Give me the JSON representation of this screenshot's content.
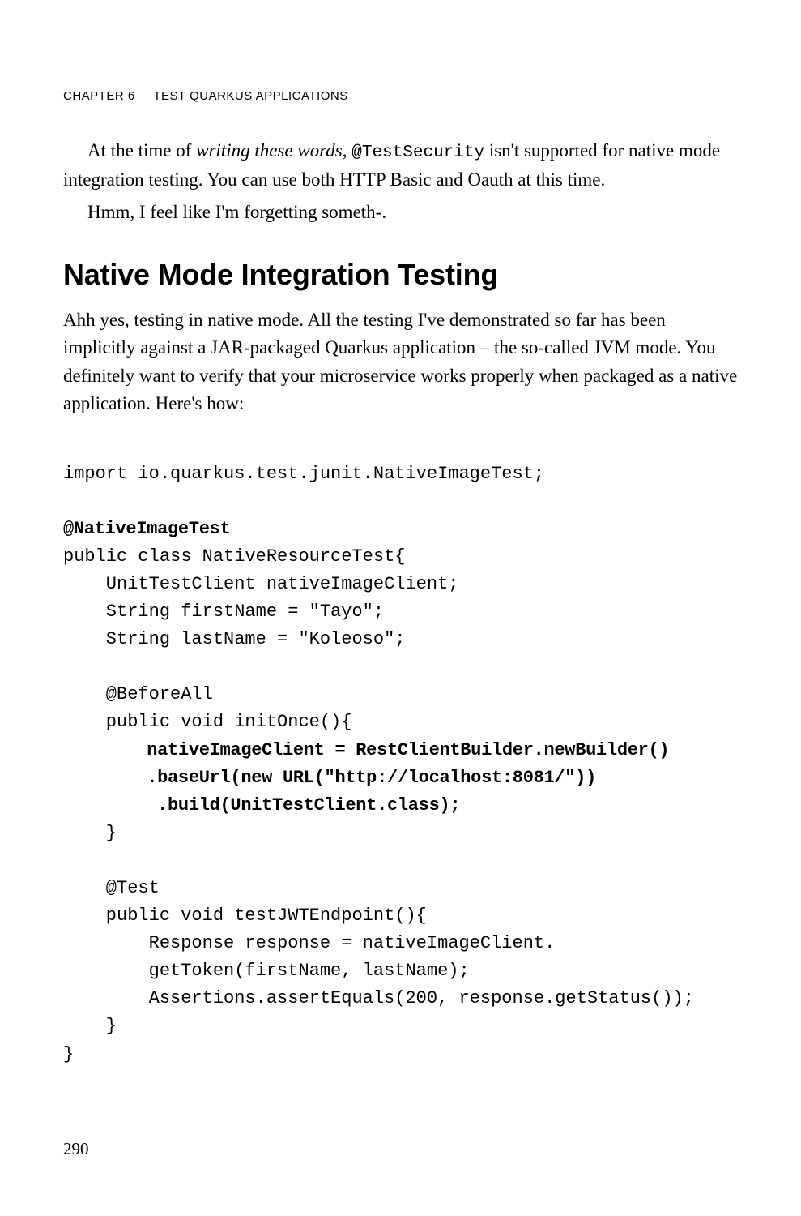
{
  "header": {
    "chapter": "Chapter 6",
    "title": "Test Quarkus Applications"
  },
  "para1": {
    "pre": "At the time of ",
    "em": "writing these words",
    "mid": ", ",
    "code": "@TestSecurity",
    "post": " isn't supported for native mode integration testing. You can use both HTTP Basic and Oauth at this time."
  },
  "para2": "Hmm, I feel like I'm forgetting someth-.",
  "heading": "Native Mode Integration Testing",
  "para3": "Ahh yes, testing in native mode. All the testing I've demonstrated so far has been implicitly against a JAR-packaged Quarkus application – the so-called JVM mode. You definitely want to verify that your microservice works properly when packaged as a native application. Here's how:",
  "code": {
    "l01": "import io.quarkus.test.junit.NativeImageTest;",
    "l02": "",
    "l03": "@NativeImageTest",
    "l04": "public class NativeResourceTest{",
    "l05": "    UnitTestClient nativeImageClient;",
    "l06": "    String firstName = \"Tayo\";",
    "l07": "    String lastName = \"Koleoso\";",
    "l08": "",
    "l09": "    @BeforeAll",
    "l10": "    public void initOnce(){",
    "l11": "        nativeImageClient = RestClientBuilder.newBuilder()",
    "l12": "        .baseUrl(new URL(\"http://localhost:8081/\"))",
    "l13": "         .build(UnitTestClient.class);",
    "l14": "    }",
    "l15": "",
    "l16": "    @Test",
    "l17": "    public void testJWTEndpoint(){",
    "l18": "        Response response = nativeImageClient.",
    "l19": "        getToken(firstName, lastName);",
    "l20": "        Assertions.assertEquals(200, response.getStatus());",
    "l21": "    }",
    "l22": "}"
  },
  "pageNumber": "290"
}
